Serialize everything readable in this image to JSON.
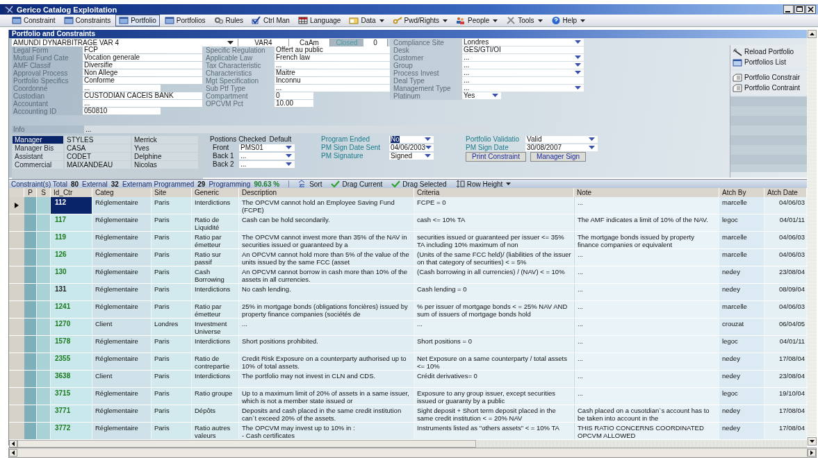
{
  "window": {
    "title": "Gerico Catalog Exploitation"
  },
  "menu": [
    {
      "label": "Constraint",
      "selected": false,
      "dropdown": false
    },
    {
      "label": "Constraints",
      "selected": false,
      "dropdown": false
    },
    {
      "label": "Portfolio",
      "selected": true,
      "dropdown": false
    },
    {
      "label": "Portfolios",
      "selected": false,
      "dropdown": false
    },
    {
      "label": "Rules",
      "selected": false,
      "dropdown": false
    },
    {
      "label": "Ctrl Man",
      "selected": false,
      "dropdown": false
    },
    {
      "label": "Language",
      "selected": false,
      "dropdown": false
    },
    {
      "label": "Data",
      "selected": false,
      "dropdown": true
    },
    {
      "label": "Pwd/Rights",
      "selected": false,
      "dropdown": true
    },
    {
      "label": "People",
      "selected": false,
      "dropdown": true
    },
    {
      "label": "Tools",
      "selected": false,
      "dropdown": true
    },
    {
      "label": "Help",
      "selected": false,
      "dropdown": true
    }
  ],
  "panel": {
    "title": "Portfolio and Constraints"
  },
  "portfolio": {
    "name": "AMUNDI DYNARBITRAGE VAR 4",
    "code": "VAR4",
    "company": "CaAm",
    "status_label": "Closed",
    "status_value": "0"
  },
  "fields_left": [
    {
      "label": "Legal Form",
      "value": "FCP",
      "kind": "text"
    },
    {
      "label": "Mutual Fund Cate",
      "value": "Vocation generale",
      "kind": "text"
    },
    {
      "label": "AMF Classif",
      "value": "Diversifie",
      "kind": "text"
    },
    {
      "label": "Approval Process",
      "value": "Non Allege",
      "kind": "text"
    },
    {
      "label": "Portfolio Specifics",
      "value": "Conforme",
      "kind": "text"
    },
    {
      "label": "Coordonné",
      "value": "...",
      "kind": "short"
    },
    {
      "label": "Custodian",
      "value": "CUSTODIAN CACEIS BANK",
      "kind": "text"
    },
    {
      "label": "Accountant",
      "value": "...",
      "kind": "text"
    },
    {
      "label": "Accounting ID",
      "value": "050810",
      "kind": "short"
    }
  ],
  "fields_middle": [
    {
      "label": "Specific Regulation",
      "value": "Offert au public",
      "kind": "text"
    },
    {
      "label": "Applicable Law",
      "value": "French law",
      "kind": "text"
    },
    {
      "label": "Tax Characteristic",
      "value": "...",
      "kind": "text"
    },
    {
      "label": "Characteristics",
      "value": "Maitre",
      "kind": "text"
    },
    {
      "label": "Mgt Specification",
      "value": "Inconnu",
      "kind": "text"
    },
    {
      "label": "Sub Ptf Type",
      "value": "...",
      "kind": "text"
    },
    {
      "label": "Compartment",
      "value": "0",
      "kind": "number"
    },
    {
      "label": "OPCVM Pct",
      "value": "10.00",
      "kind": "number"
    }
  ],
  "fields_right": [
    {
      "label": "Compliance Site",
      "value": "Londres",
      "kind": "combo"
    },
    {
      "label": "Desk",
      "value": "GES/GTI/OI",
      "kind": "text"
    },
    {
      "label": "Customer",
      "value": "...",
      "kind": "combo"
    },
    {
      "label": "Group",
      "value": "...",
      "kind": "combo"
    },
    {
      "label": "Process Invest",
      "value": "...",
      "kind": "combo"
    },
    {
      "label": "Deal Type",
      "value": "...",
      "kind": "text"
    },
    {
      "label": "Management Type",
      "value": "...",
      "kind": "combo"
    },
    {
      "label": "Platinum",
      "value": "Yes",
      "kind": "short_combo"
    }
  ],
  "info": {
    "label": "Info",
    "value": "..."
  },
  "people": [
    {
      "role": "Manager",
      "last_name": "STYLES",
      "first_name": "Merrick",
      "selected": true
    },
    {
      "role": "Manager Bis",
      "last_name": "CASA",
      "first_name": "Yves",
      "selected": false
    },
    {
      "role": "Assistant",
      "last_name": "CODET",
      "first_name": "Delphine",
      "selected": false
    },
    {
      "role": "Commercial",
      "last_name": "MAIXANDEAU",
      "first_name": "Nicolas",
      "selected": false
    }
  ],
  "positions": {
    "header": "Postions Checked",
    "default_label": "Default",
    "rows": [
      {
        "label": "Front",
        "value": "PMS01"
      },
      {
        "label": "Back 1",
        "value": "..."
      },
      {
        "label": "Back 2",
        "value": "..."
      }
    ]
  },
  "program": [
    {
      "label": "Program Ended",
      "value": "No",
      "highlighted": true
    },
    {
      "label": "PM Sign Date Sent",
      "value": "04/06/2003",
      "highlighted": false
    },
    {
      "label": "PM Signature",
      "value": "Signed",
      "highlighted": false
    }
  ],
  "validation": [
    {
      "label": "Portfolio Validatio",
      "value": "Valid"
    },
    {
      "label": "PM Sign Date",
      "value": "30/08/2007"
    }
  ],
  "buttons": [
    "Print Constraint",
    "Manager Sign"
  ],
  "side_panel": {
    "groups": [
      [
        "Reload Portfolio",
        "Portfolios List"
      ],
      [
        "Portfolio Constrair",
        "Portfolio Contraint"
      ]
    ]
  },
  "stats": [
    {
      "label": "Constraint(s) Total",
      "value": "80",
      "kind": "count"
    },
    {
      "label": "External",
      "value": "32",
      "kind": "count"
    },
    {
      "label": "Externam Programmed",
      "value": "29",
      "kind": "count"
    },
    {
      "label": "Programming",
      "value": "90.63 %",
      "kind": "percent"
    }
  ],
  "toolbar": [
    {
      "label": "Sort",
      "dropdown": false
    },
    {
      "label": "Drag Current",
      "dropdown": false
    },
    {
      "label": "Drag Selected",
      "dropdown": false
    },
    {
      "label": "Row Height",
      "dropdown": true
    }
  ],
  "table": {
    "columns": [
      "P",
      "S",
      "Id_Ctr",
      "Categ",
      "Site",
      "Generic",
      "Description",
      "Criteria",
      "Note",
      "Atch By",
      "Atch Date"
    ],
    "rows": [
      {
        "selected": true,
        "cells": [
          "",
          "",
          "112",
          "Réglementaire",
          "Paris",
          "Interdictions",
          "The OPCVM cannot hold an Employee Saving Fund (FCPE)",
          "FCPE = 0",
          "...",
          "marcelle",
          "04/06/03"
        ]
      },
      {
        "selected": false,
        "color": "#1e7a1e",
        "cells": [
          "",
          "",
          "117",
          "Réglementaire",
          "Paris",
          "Ratio de Liquidité",
          "Cash can be hold secondarily.",
          "cash <= 10% TA",
          "The AMF indicates a limit of 10% of the NAV.",
          "legoc",
          "04/01/11"
        ]
      },
      {
        "selected": false,
        "color": "#1e7a1e",
        "cells": [
          "",
          "",
          "119",
          "Réglementaire",
          "Paris",
          "Ratio par émetteur",
          "The OPCVM cannot invest more than 35% of the NAV in securities issued or guaranteed by a",
          "securities issued or guaranteed per issuer <= 35% TA including 10% maximum of non",
          "The mortgage bonds issued by property finance companies or equivalent",
          "marcelle",
          "04/06/03"
        ]
      },
      {
        "selected": false,
        "color": "#1e7a1e",
        "cells": [
          "",
          "",
          "126",
          "Réglementaire",
          "Paris",
          "Ratio sur passif",
          "An OPCVM cannot hold more than 5% of the value of the units issued by the same FCC (asset",
          "(Units of the same FCC held)/ (liabilities of the issuer on that category of securities) < = 5%",
          "...",
          "marcelle",
          "04/06/03"
        ]
      },
      {
        "selected": false,
        "color": "#1e7a1e",
        "cells": [
          "",
          "",
          "130",
          "Réglementaire",
          "Paris",
          "Cash Borrowing",
          "An OPCVM cannot borrow in cash more than 10% of the assets in all currencies.",
          "(Cash borrowing in all currencies) / (NAV) < = 10%",
          "...",
          "nedey",
          "23/08/04"
        ]
      },
      {
        "selected": false,
        "color": "#222222",
        "cells": [
          "",
          "",
          "131",
          "Réglementaire",
          "Paris",
          "Interdictions",
          "No cash lending.",
          "Cash lending = 0",
          "...",
          "nedey",
          "08/09/04"
        ]
      },
      {
        "selected": false,
        "color": "#1e7a1e",
        "cells": [
          "",
          "",
          "1241",
          "Réglementaire",
          "Paris",
          "Ratio par émetteur",
          "25% in mortgage bonds (obligations foncières) issued by property finance companies (sociétés de",
          "% per issuer of mortgage bonds < = 25% NAV AND sum of issuers of mortgage bonds hold",
          "...",
          "marcelle",
          "04/06/03"
        ]
      },
      {
        "selected": false,
        "color": "#1e7a1e",
        "cells": [
          "",
          "",
          "1270",
          "Client",
          "Londres",
          "Investment Universe",
          "...",
          "...",
          "...",
          "crouzat",
          "06/04/05"
        ]
      },
      {
        "selected": false,
        "color": "#1e7a1e",
        "cells": [
          "",
          "",
          "1578",
          "Réglementaire",
          "Paris",
          "Interdictions",
          "Short positions prohibited.",
          "Short positions = 0",
          "...",
          "legoc",
          "04/01/11"
        ]
      },
      {
        "selected": false,
        "color": "#1e7a1e",
        "cells": [
          "",
          "",
          "2355",
          "Réglementaire",
          "Paris",
          "Ratio de contrepartie",
          "Credit Risk Exposure on a counterparty authorised up to 10% of total assets.",
          "Net Exposure on a same counterparty / total assets <= 10%",
          "...",
          "nedey",
          "17/08/04"
        ]
      },
      {
        "selected": false,
        "color": "#1e7a1e",
        "cells": [
          "",
          "",
          "3638",
          "Client",
          "Paris",
          "Interdictions",
          "The portfolio may not invest in CLN and CDS.",
          "Crédit derivatives= 0",
          "...",
          "nedey",
          "23/08/04"
        ]
      },
      {
        "selected": false,
        "color": "#1e7a1e",
        "cells": [
          "",
          "",
          "3715",
          "Réglementaire",
          "Paris",
          "Ratio groupe",
          "Up to a maximum limit of 20% of assets in a same issuer, which is not a member state issued or",
          "Exposure to any group issuer, except securities issued or guaranty by a  public",
          "...",
          "legoc",
          "19/10/04"
        ]
      },
      {
        "selected": false,
        "color": "#1e7a1e",
        "cells": [
          "",
          "",
          "3771",
          "Réglementaire",
          "Paris",
          "Dépôts",
          "Deposits and cash placed in the same credit institution can`t exceed 20% of the assets.",
          "Sight deposit + Short term deposit placed in the same credit institution < = 20% NAV",
          "Cash placed on a cusotdian`s account has to be taken into account in the",
          "nedey",
          "17/08/04"
        ]
      },
      {
        "selected": false,
        "color": "#1e7a1e",
        "cells": [
          "",
          "",
          "3772",
          "Réglementaire",
          "Paris",
          "Ratio autres valeurs",
          "The OPCVM may invest up to 10% in :\n- Cash certificates",
          "Instruments listed as \"others assets\" < = 10% TA",
          "THIS RATIO CONCERNS COORDINATED OPCVM ALLOWED",
          "nedey",
          "17/08/04"
        ]
      }
    ]
  }
}
